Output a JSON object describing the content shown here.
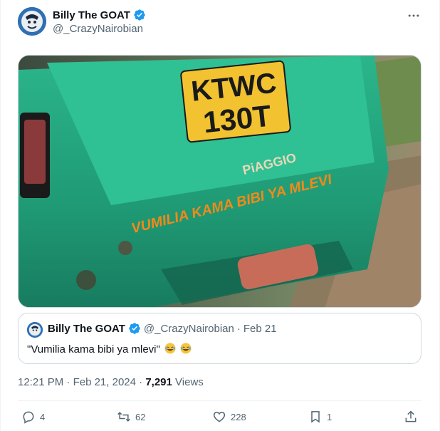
{
  "author": {
    "display_name": "Billy The GOAT",
    "handle": "@_CrazyNairobian"
  },
  "media": {
    "plate_line1": "KTWC",
    "plate_line2": "130T",
    "brand": "PiAGGIO",
    "slogan": "VUMILIA KAMA BIBI YA MLEVI"
  },
  "quote": {
    "display_name": "Billy The GOAT",
    "handle": "@_CrazyNairobian",
    "separator": "·",
    "date": "Feb 21",
    "text": "\"Vumilia kama bibi ya mlevi\""
  },
  "meta": {
    "time": "12:21 PM",
    "separator": "·",
    "date": "Feb 21, 2024",
    "views_count": "7,291",
    "views_label": "Views"
  },
  "actions": {
    "replies": "4",
    "reposts": "62",
    "likes": "228",
    "bookmarks": "1"
  },
  "colors": {
    "verified": "#1d9bf0",
    "text_secondary": "#536471",
    "truck_green": "#25a37a",
    "plate_yellow": "#f2c230",
    "slogan_orange": "#f08a1a"
  }
}
